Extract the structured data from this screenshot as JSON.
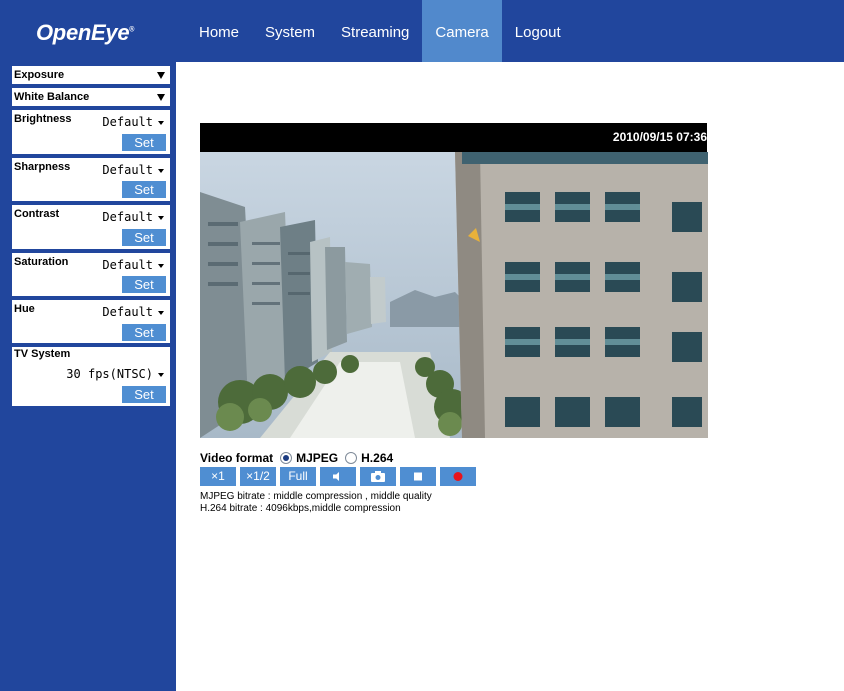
{
  "app": {
    "logo": "OpenEye",
    "logo_mark": "®"
  },
  "nav": [
    {
      "label": "Home"
    },
    {
      "label": "System"
    },
    {
      "label": "Streaming"
    },
    {
      "label": "Camera",
      "active": true
    },
    {
      "label": "Logout"
    }
  ],
  "sidebar": {
    "exposure": "Exposure",
    "white_balance": "White Balance",
    "brightness": {
      "label": "Brightness",
      "value": "Default",
      "set": "Set"
    },
    "sharpness": {
      "label": "Sharpness",
      "value": "Default",
      "set": "Set"
    },
    "contrast": {
      "label": "Contrast",
      "value": "Default",
      "set": "Set"
    },
    "saturation": {
      "label": "Saturation",
      "value": "Default",
      "set": "Set"
    },
    "hue": {
      "label": "Hue",
      "value": "Default",
      "set": "Set"
    },
    "tv_system": {
      "label": "TV System",
      "value": "30 fps(NTSC)",
      "set": "Set"
    }
  },
  "video": {
    "timestamp": "2010/09/15 07:36",
    "format_label": "Video format",
    "format_options": [
      {
        "label": "MJPEG",
        "selected": true
      },
      {
        "label": "H.264",
        "selected": false
      }
    ],
    "controls": {
      "x1": "×1",
      "x_half": "×1/2",
      "full": "Full",
      "speaker_icon": "speaker-icon",
      "camera_icon": "camera-icon",
      "stop_icon": "stop-icon",
      "record_icon": "record-icon"
    },
    "mjpeg_info": "MJPEG bitrate : middle compression , middle quality",
    "h264_info": "H.264 bitrate : 4096kbps,middle compression"
  },
  "colors": {
    "brand_blue": "#21469d",
    "active_tab": "#5189cc",
    "button_blue": "#4f8ed2",
    "record_red": "#e8141c"
  }
}
